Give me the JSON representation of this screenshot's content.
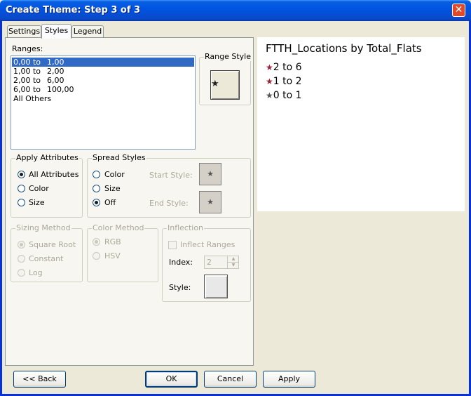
{
  "window": {
    "title": "Create Theme: Step 3 of 3",
    "close_glyph": "✕"
  },
  "tabs": [
    {
      "label": "Settings",
      "active": false
    },
    {
      "label": "Styles",
      "active": true
    },
    {
      "label": "Legend",
      "active": false
    }
  ],
  "ranges": {
    "label": "Ranges:",
    "items": [
      {
        "from": "0,00 to",
        "to": "1,00",
        "selected": true
      },
      {
        "from": "1,00 to",
        "to": "2,00",
        "selected": false
      },
      {
        "from": "2,00 to",
        "to": "6,00",
        "selected": false
      },
      {
        "from": "6,00 to",
        "to": "100,00",
        "selected": false
      },
      {
        "from": "All Others",
        "to": "",
        "selected": false
      }
    ]
  },
  "range_style": {
    "label": "Range Style",
    "symbol": "★"
  },
  "apply_attributes": {
    "label": "Apply Attributes",
    "options": [
      {
        "label": "All Attributes",
        "checked": true
      },
      {
        "label": "Color",
        "checked": false
      },
      {
        "label": "Size",
        "checked": false
      }
    ]
  },
  "spread_styles": {
    "label": "Spread Styles",
    "options": [
      {
        "label": "Color",
        "checked": false
      },
      {
        "label": "Size",
        "checked": false
      },
      {
        "label": "Off",
        "checked": true
      }
    ],
    "start_style_label": "Start Style:",
    "end_style_label": "End Style:",
    "symbol": "★"
  },
  "sizing_method": {
    "label": "Sizing Method",
    "options": [
      {
        "label": "Square Root",
        "checked": true
      },
      {
        "label": "Constant",
        "checked": false
      },
      {
        "label": "Log",
        "checked": false
      }
    ]
  },
  "color_method": {
    "label": "Color Method",
    "options": [
      {
        "label": "RGB",
        "checked": true
      },
      {
        "label": "HSV",
        "checked": false
      }
    ]
  },
  "inflection": {
    "label": "Inflection",
    "inflect_label": "Inflect Ranges",
    "index_label": "Index:",
    "index_value": "2",
    "style_label": "Style:"
  },
  "preview": {
    "title": "FTTH_Locations by Total_Flats",
    "symbol": "★",
    "rows": [
      {
        "label": "2 to 6",
        "color": "#9a2436"
      },
      {
        "label": "1 to 2",
        "color": "#9a2436"
      },
      {
        "label": "0 to 1",
        "color": "#555555"
      }
    ]
  },
  "buttons": {
    "back": "<< Back",
    "ok": "OK",
    "cancel": "Cancel",
    "apply": "Apply"
  }
}
